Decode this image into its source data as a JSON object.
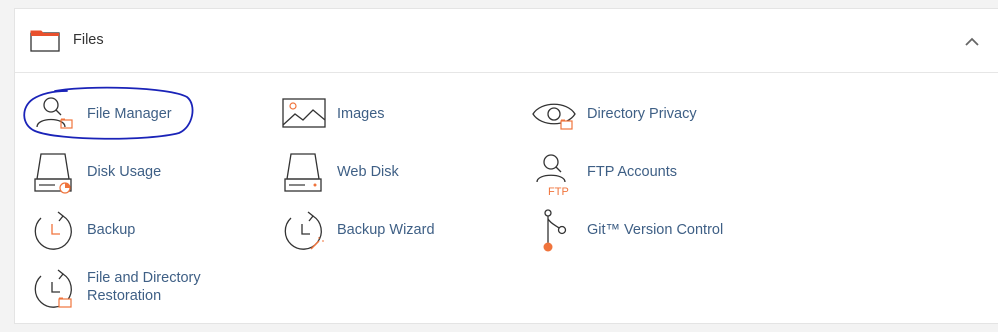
{
  "section": {
    "title": "Files",
    "items": [
      {
        "label": "File Manager"
      },
      {
        "label": "Images"
      },
      {
        "label": "Directory Privacy"
      },
      {
        "label": "Disk Usage"
      },
      {
        "label": "Web Disk"
      },
      {
        "label": "FTP Accounts"
      },
      {
        "label": "Backup"
      },
      {
        "label": "Backup Wizard"
      },
      {
        "label": "Git™ Version Control"
      },
      {
        "label_line1": "File and Directory",
        "label_line2": "Restoration"
      }
    ]
  },
  "icons": {
    "header": "folder-icon",
    "collapse": "chevron-up-icon",
    "file_manager": "user-folder-icon",
    "images": "image-icon",
    "directory_privacy": "eye-folder-icon",
    "disk_usage": "disk-pie-icon",
    "web_disk": "disk-icon",
    "ftp_accounts": "user-ftp-icon",
    "backup": "clock-refresh-icon",
    "backup_wizard": "clock-wand-icon",
    "git": "git-branch-icon",
    "restoration": "clock-folder-icon"
  },
  "highlight_annotation": "hand-drawn-circle",
  "colors": {
    "text_link": "#3e5f85",
    "icon_stroke": "#333333",
    "icon_accent": "#f0743c",
    "annotation": "#1a23b8",
    "header_accent": "#e8502d"
  }
}
